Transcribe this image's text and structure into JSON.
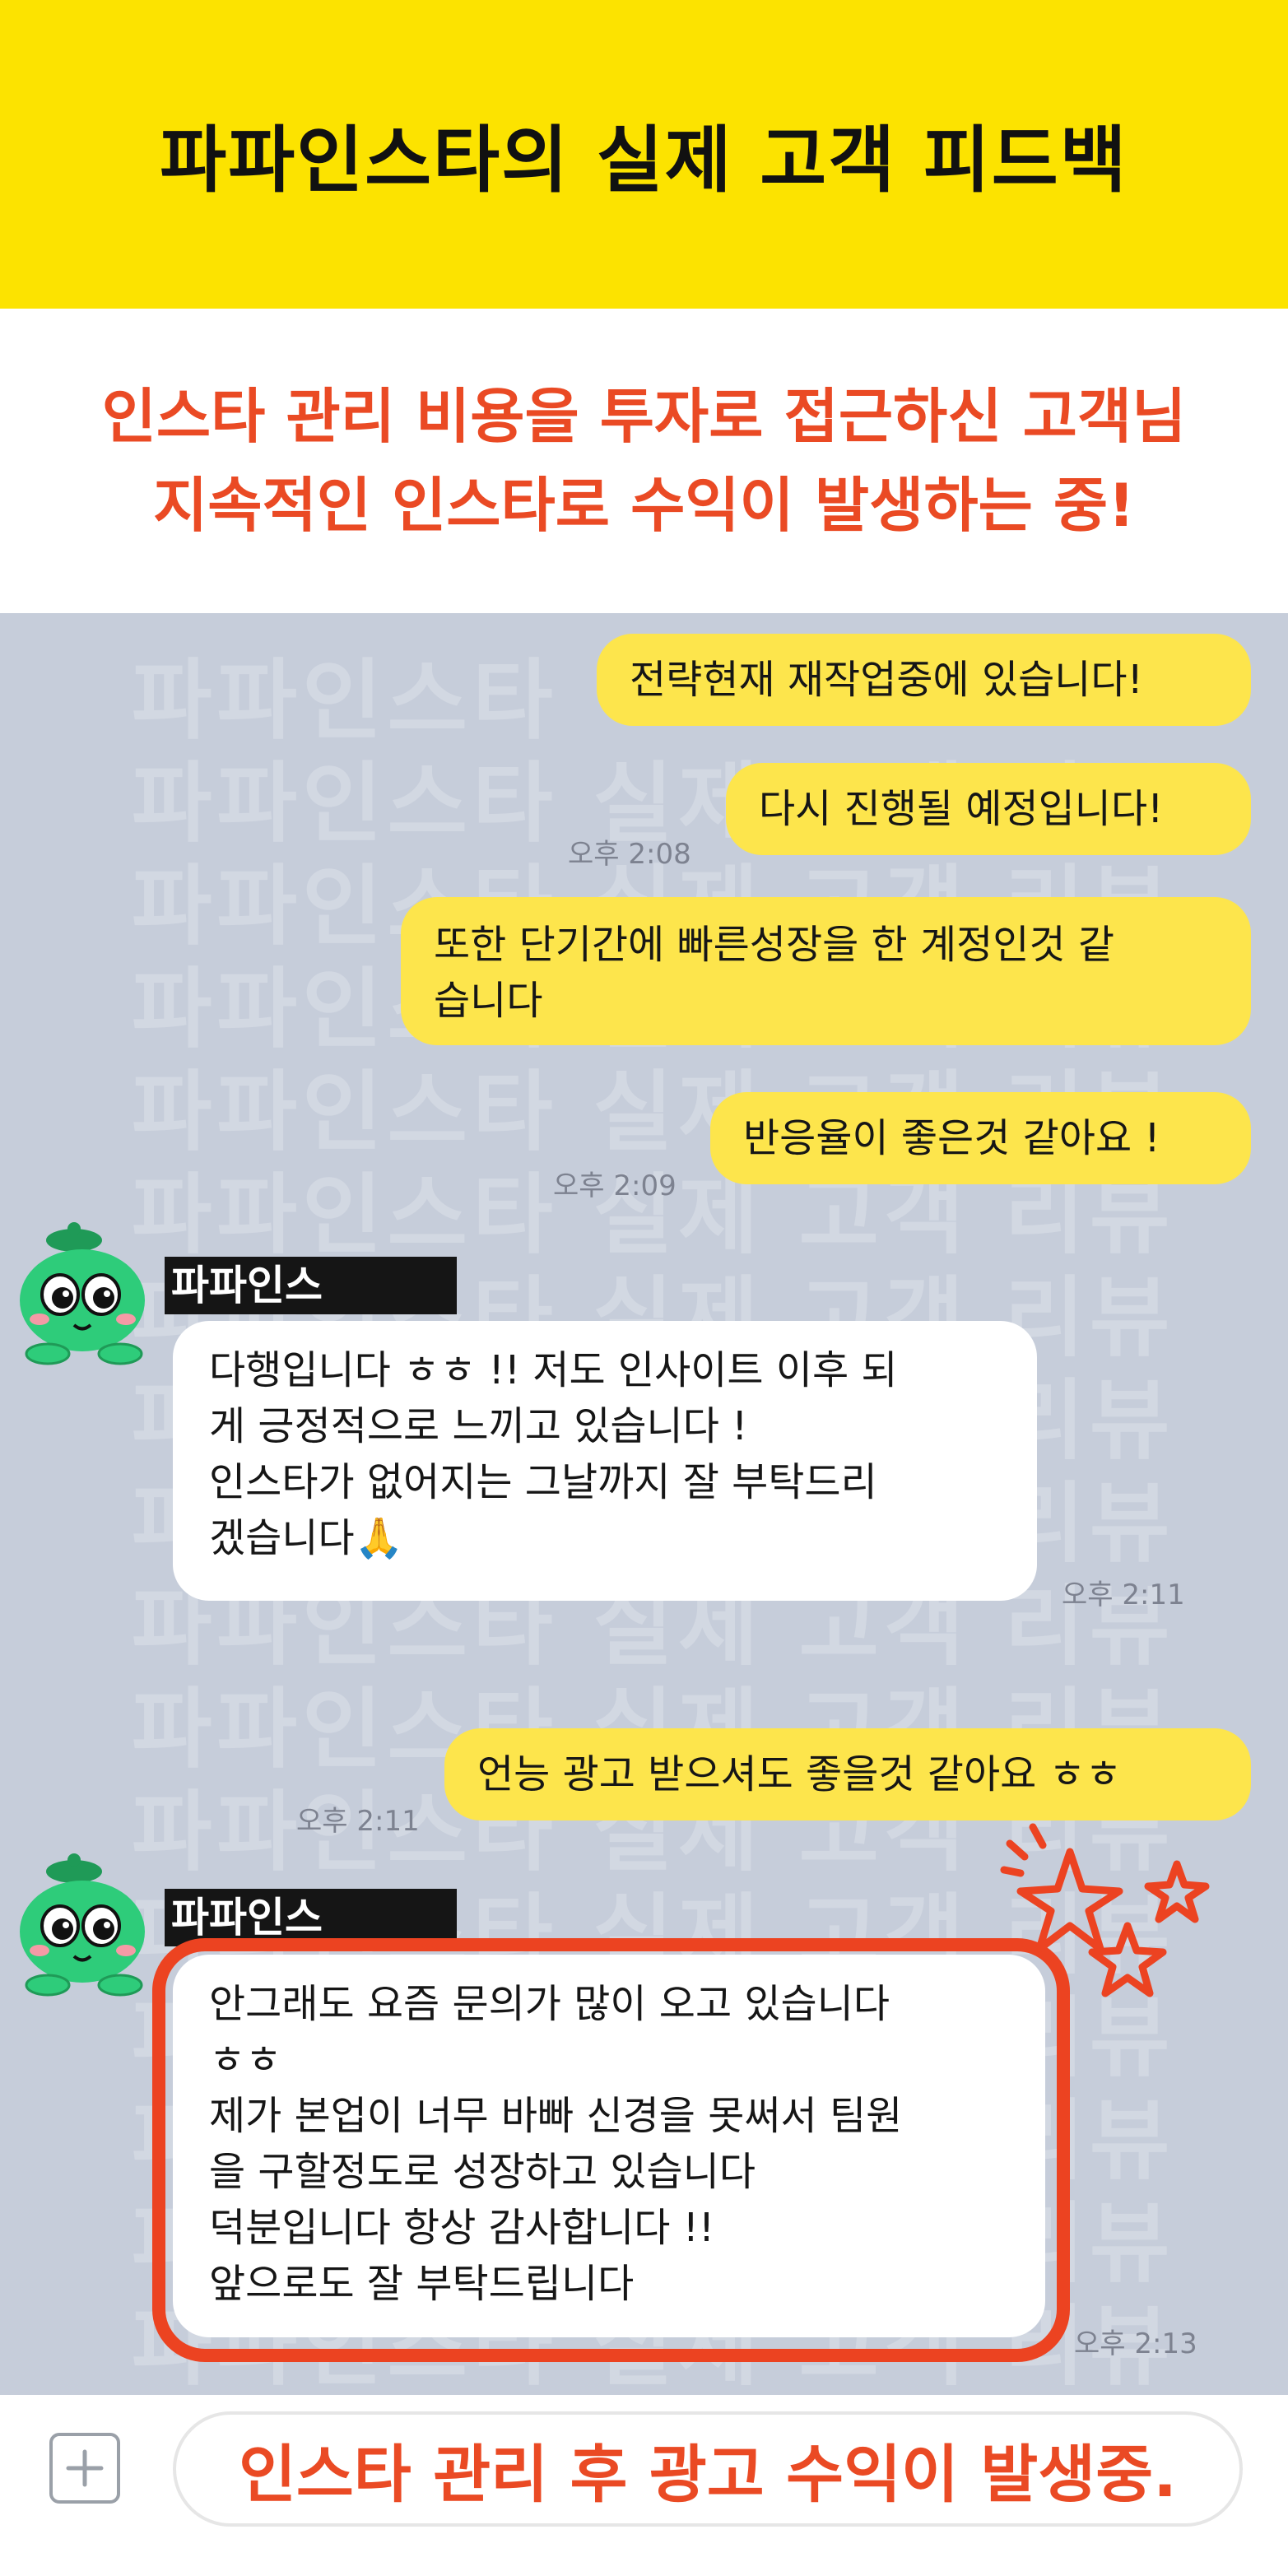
{
  "header": {
    "title": "파파인스타의 실제 고객 피드백"
  },
  "subtitle": {
    "line1": "인스타 관리 비용을 투자로 접근하신 고객님",
    "line2": "지속적인 인스타로 수익이 발생하는 중!"
  },
  "chat": {
    "watermark": {
      "brand": "파파인스타",
      "phrase": "파파인스타 실제 고객 리뷰"
    },
    "sender_name": "파파인스",
    "messages": {
      "m1": "전략현재 재작업중에 있습니다!",
      "m2": "다시 진행될 예정입니다!",
      "m2_time": "오후 2:08",
      "m3": [
        "또한 단기간에 빠른성장을 한 계정인것 같",
        "습니다"
      ],
      "m4": "반응율이 좋은것 같아요 !",
      "m4_time": "오후 2:09",
      "r1": [
        "다행입니다 ㅎㅎ !! 저도 인사이트 이후 되",
        "게 긍정적으로 느끼고 있습니다 !",
        "인스타가 없어지는 그날까지 잘 부탁드리",
        "겠습니다🙏"
      ],
      "r1_time": "오후 2:11",
      "m5": "언능 광고 받으셔도 좋을것 같아요 ㅎㅎ",
      "m5_time": "오후 2:11",
      "r2": [
        "안그래도 요즘 문의가 많이 오고 있습니다",
        "ㅎㅎ",
        "제가 본업이 너무 바빠 신경을 못써서 팀원",
        "을 구할정도로 성장하고 있습니다",
        "덕분입니다 항상 감사합니다 !!",
        "앞으로도 잘 부탁드립니다"
      ],
      "r2_time": "오후 2:13"
    }
  },
  "input": {
    "overlay_text": "인스타 관리 후 광고 수익이 발생중."
  },
  "colors": {
    "header_bg": "#fce300",
    "accent_red": "#ea4a24",
    "chat_bg": "#c6cdda",
    "my_bubble": "#fde54c",
    "other_bubble": "#ffffff",
    "avatar_green": "#2ecc7a"
  },
  "icons": {
    "avatar": "green-mascot-icon",
    "plus": "plus-icon",
    "stars": "star-doodle-icon"
  }
}
